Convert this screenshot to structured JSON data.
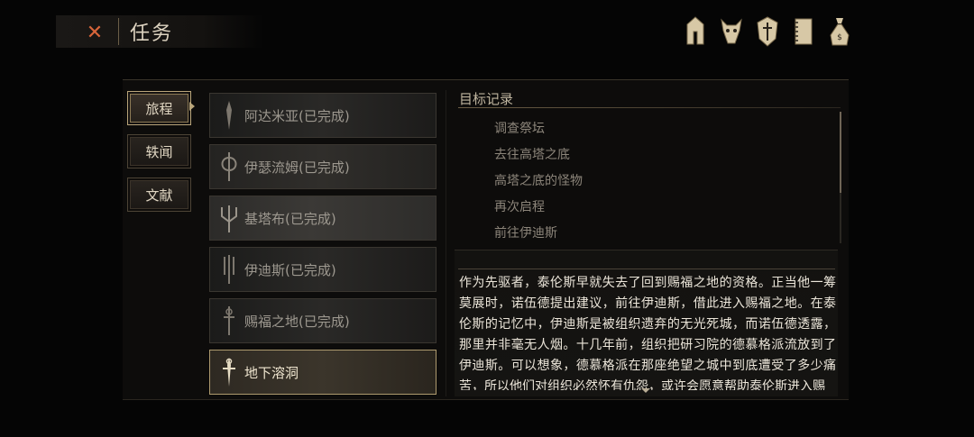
{
  "header": {
    "close_icon": "x-icon",
    "title": "任务"
  },
  "top_icons": [
    "helmet-icon",
    "beast-head-icon",
    "shield-icon",
    "journal-icon",
    "money-bag-icon"
  ],
  "tabs": [
    {
      "label": "旅程",
      "active": true
    },
    {
      "label": "轶闻",
      "active": false
    },
    {
      "label": "文献",
      "active": false
    }
  ],
  "quests": [
    {
      "label": "阿达米亚(已完成)",
      "icon": "spear-icon"
    },
    {
      "label": "伊瑟流姆(已完成)",
      "icon": "axe-icon"
    },
    {
      "label": "基塔布(已完成)",
      "icon": "trident-icon"
    },
    {
      "label": "伊迪斯(已完成)",
      "icon": "claw-icon"
    },
    {
      "label": "赐福之地(已完成)",
      "icon": "staff-icon"
    },
    {
      "label": "地下溶洞",
      "icon": "dagger-icon",
      "selected": true
    }
  ],
  "objectives": {
    "title": "目标记录",
    "items": [
      "调查祭坛",
      "去往高塔之底",
      "高塔之底的怪物",
      "再次启程",
      "前往伊迪斯"
    ]
  },
  "description": "作为先驱者，泰伦斯早就失去了回到赐福之地的资格。正当他一筹莫展时，诺伍德提出建议，前往伊迪斯，借此进入赐福之地。在泰伦斯的记忆中，伊迪斯是被组织遗弃的无光死城，而诺伍德透露，那里并非毫无人烟。十几年前，组织把研习院的德慕格派流放到了伊迪斯。可以想象，德慕格派在那座绝望之城中到底遭受了多少痛苦，所以他们对组织必然怀有仇怨，或许会愿意帮助泰伦斯进入赐"
}
